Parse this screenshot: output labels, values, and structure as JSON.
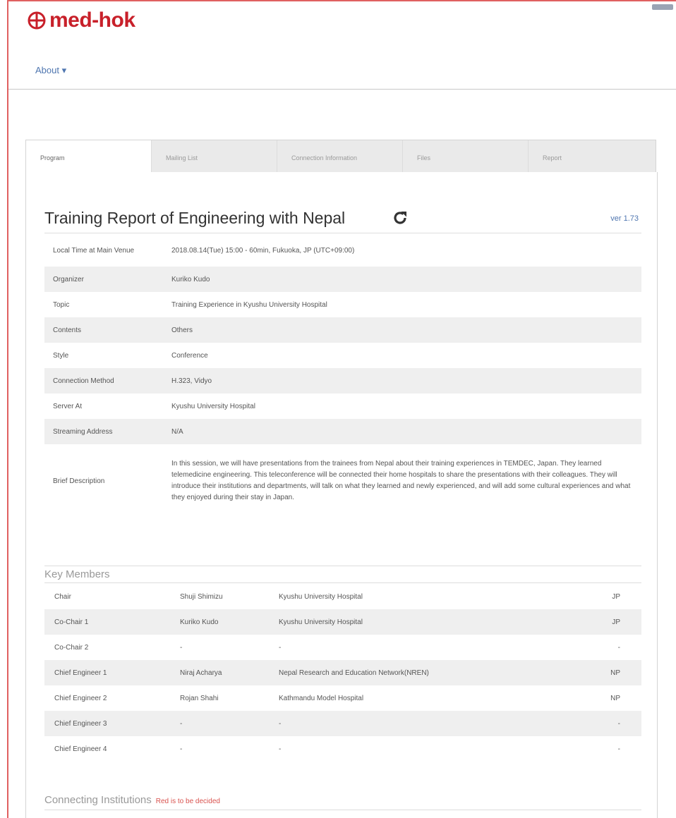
{
  "brand": {
    "name": "med-hok",
    "color": "#c8202a"
  },
  "nav": {
    "about": "About ▾"
  },
  "tabs": [
    "Program",
    "Mailing List",
    "Connection Information",
    "Files",
    "Report"
  ],
  "program": {
    "title": "Training Report of Engineering with Nepal",
    "refresh_icon": "refresh-icon",
    "version": "ver 1.73",
    "rows": [
      {
        "label": "Local Time at Main Venue",
        "value": "2018.08.14(Tue) 15:00 - 60min, Fukuoka, JP (UTC+09:00)"
      },
      {
        "label": "Organizer",
        "value": "Kuriko Kudo"
      },
      {
        "label": "Topic",
        "value": "Training Experience in Kyushu University Hospital"
      },
      {
        "label": "Contents",
        "value": "Others"
      },
      {
        "label": "Style",
        "value": "Conference"
      },
      {
        "label": "Connection Method",
        "value": "H.323, Vidyo"
      },
      {
        "label": "Server At",
        "value": "Kyushu University Hospital"
      },
      {
        "label": "Streaming Address",
        "value": "N/A"
      },
      {
        "label": "Brief Description",
        "value": "In this session, we will have presentations from the trainees from Nepal about their training experiences in TEMDEC, Japan. They learned telemedicine engineering. This teleconference will be connected their home hospitals to share the presentations with their colleagues. They will introduce their institutions and departments, will talk on what they learned and newly experienced, and will add some cultural experiences and what they enjoyed during their stay in Japan."
      }
    ]
  },
  "key_members": {
    "title": "Key Members",
    "rows": [
      {
        "role": "Chair",
        "name": "Shuji Shimizu",
        "org": "Kyushu University Hospital",
        "country": "JP"
      },
      {
        "role": "Co-Chair 1",
        "name": "Kuriko Kudo",
        "org": "Kyushu University Hospital",
        "country": "JP"
      },
      {
        "role": "Co-Chair 2",
        "name": "-",
        "org": "-",
        "country": "-"
      },
      {
        "role": "Chief Engineer 1",
        "name": "Niraj Acharya",
        "org": "Nepal Research and Education Network(NREN)",
        "country": "NP"
      },
      {
        "role": "Chief Engineer 2",
        "name": "Rojan Shahi",
        "org": "Kathmandu Model Hospital",
        "country": "NP"
      },
      {
        "role": "Chief Engineer 3",
        "name": "-",
        "org": "-",
        "country": "-"
      },
      {
        "role": "Chief Engineer 4",
        "name": "-",
        "org": "-",
        "country": "-"
      }
    ]
  },
  "connecting_institutions": {
    "title": "Connecting Institutions",
    "note": "Red is to be decided"
  },
  "colors": {
    "accent_red": "#d9534f",
    "link_blue": "#4f76b0",
    "row_shade": "#efefef"
  }
}
